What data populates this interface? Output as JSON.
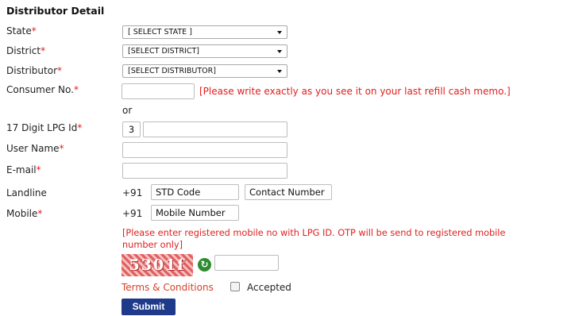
{
  "title": "Distributor Detail",
  "labels": {
    "state": "State",
    "district": "District",
    "distributor": "Distributor",
    "consumer_no": "Consumer No.",
    "lpg_id": "17 Digit LPG Id",
    "user_name": "User Name",
    "email": "E-mail",
    "landline": "Landline",
    "mobile": "Mobile",
    "required_mark": "*"
  },
  "selects": {
    "state": "[ SELECT STATE ]",
    "district": "[SELECT DISTRICT]",
    "distributor": "[SELECT DISTRIBUTOR]"
  },
  "consumer_note": "[Please write exactly as you see it on your last refill cash memo.]",
  "or_text": "or",
  "lpg_prefix": "3",
  "country_code": "+91",
  "placeholders": {
    "std_code": "STD Code",
    "contact_number": "Contact Number",
    "mobile_number": "Mobile Number"
  },
  "mobile_note_line1": "[Please enter registered mobile no with LPG ID. OTP will be send to registered mobile",
  "mobile_note_line2": "number only]",
  "captcha_text": "5301f",
  "terms_link": "Terms & Conditions",
  "accepted_label": "Accepted",
  "submit_label": "Submit",
  "colors": {
    "required": "#e02020",
    "submit_bg": "#1f3a8a",
    "terms_link": "#d5402a"
  }
}
